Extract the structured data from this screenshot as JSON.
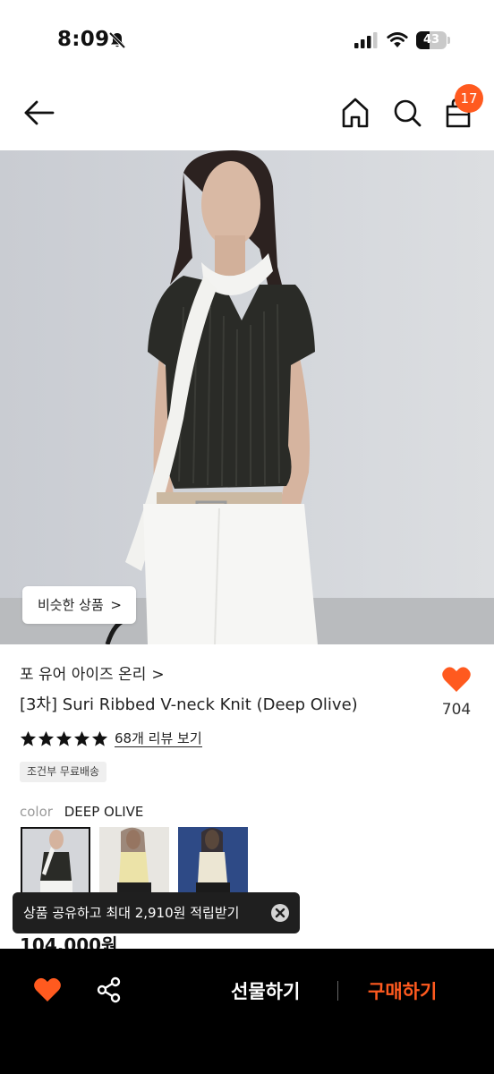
{
  "status_bar": {
    "time": "8:09",
    "battery": "43",
    "battery_level": 0.43,
    "icons": [
      "bell-off-icon",
      "cellular-signal-icon",
      "wifi-icon",
      "battery-icon"
    ]
  },
  "header": {
    "cart_count": "17",
    "icons": [
      "back-arrow-icon",
      "home-icon",
      "search-icon",
      "shopping-bag-icon"
    ]
  },
  "hero": {
    "similar_label": "비슷한 상품",
    "chevron": ">"
  },
  "product": {
    "brand": "포 유어 아이즈 온리",
    "brand_chevron": ">",
    "title": "[3차] Suri Ribbed V-neck Knit (Deep Olive)",
    "like_count": "704",
    "rating_stars": 5,
    "review_link": "68개 리뷰 보기",
    "shipping_badge": "조건부 무료배송",
    "color_label": "color",
    "color_value": "DEEP OLIVE",
    "price": "104,000원"
  },
  "toast": {
    "message": "상품 공유하고 최대 2,910원 적립받기"
  },
  "bottom_bar": {
    "gift_label": "선물하기",
    "buy_label": "구매하기"
  },
  "colors": {
    "accent": "#ff5a1f",
    "bottom_bar_bg": "#000000",
    "toast_bg": "#1f1f1f"
  }
}
